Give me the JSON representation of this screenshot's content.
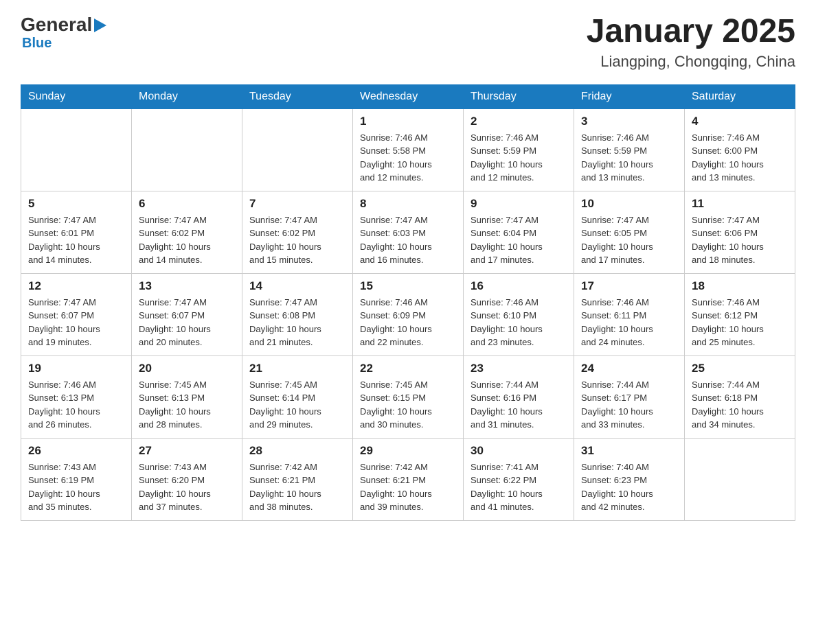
{
  "header": {
    "logo_general": "General",
    "logo_blue": "Blue",
    "month_year": "January 2025",
    "location": "Liangping, Chongqing, China"
  },
  "days_of_week": [
    "Sunday",
    "Monday",
    "Tuesday",
    "Wednesday",
    "Thursday",
    "Friday",
    "Saturday"
  ],
  "weeks": [
    [
      {
        "day": "",
        "info": ""
      },
      {
        "day": "",
        "info": ""
      },
      {
        "day": "",
        "info": ""
      },
      {
        "day": "1",
        "info": "Sunrise: 7:46 AM\nSunset: 5:58 PM\nDaylight: 10 hours\nand 12 minutes."
      },
      {
        "day": "2",
        "info": "Sunrise: 7:46 AM\nSunset: 5:59 PM\nDaylight: 10 hours\nand 12 minutes."
      },
      {
        "day": "3",
        "info": "Sunrise: 7:46 AM\nSunset: 5:59 PM\nDaylight: 10 hours\nand 13 minutes."
      },
      {
        "day": "4",
        "info": "Sunrise: 7:46 AM\nSunset: 6:00 PM\nDaylight: 10 hours\nand 13 minutes."
      }
    ],
    [
      {
        "day": "5",
        "info": "Sunrise: 7:47 AM\nSunset: 6:01 PM\nDaylight: 10 hours\nand 14 minutes."
      },
      {
        "day": "6",
        "info": "Sunrise: 7:47 AM\nSunset: 6:02 PM\nDaylight: 10 hours\nand 14 minutes."
      },
      {
        "day": "7",
        "info": "Sunrise: 7:47 AM\nSunset: 6:02 PM\nDaylight: 10 hours\nand 15 minutes."
      },
      {
        "day": "8",
        "info": "Sunrise: 7:47 AM\nSunset: 6:03 PM\nDaylight: 10 hours\nand 16 minutes."
      },
      {
        "day": "9",
        "info": "Sunrise: 7:47 AM\nSunset: 6:04 PM\nDaylight: 10 hours\nand 17 minutes."
      },
      {
        "day": "10",
        "info": "Sunrise: 7:47 AM\nSunset: 6:05 PM\nDaylight: 10 hours\nand 17 minutes."
      },
      {
        "day": "11",
        "info": "Sunrise: 7:47 AM\nSunset: 6:06 PM\nDaylight: 10 hours\nand 18 minutes."
      }
    ],
    [
      {
        "day": "12",
        "info": "Sunrise: 7:47 AM\nSunset: 6:07 PM\nDaylight: 10 hours\nand 19 minutes."
      },
      {
        "day": "13",
        "info": "Sunrise: 7:47 AM\nSunset: 6:07 PM\nDaylight: 10 hours\nand 20 minutes."
      },
      {
        "day": "14",
        "info": "Sunrise: 7:47 AM\nSunset: 6:08 PM\nDaylight: 10 hours\nand 21 minutes."
      },
      {
        "day": "15",
        "info": "Sunrise: 7:46 AM\nSunset: 6:09 PM\nDaylight: 10 hours\nand 22 minutes."
      },
      {
        "day": "16",
        "info": "Sunrise: 7:46 AM\nSunset: 6:10 PM\nDaylight: 10 hours\nand 23 minutes."
      },
      {
        "day": "17",
        "info": "Sunrise: 7:46 AM\nSunset: 6:11 PM\nDaylight: 10 hours\nand 24 minutes."
      },
      {
        "day": "18",
        "info": "Sunrise: 7:46 AM\nSunset: 6:12 PM\nDaylight: 10 hours\nand 25 minutes."
      }
    ],
    [
      {
        "day": "19",
        "info": "Sunrise: 7:46 AM\nSunset: 6:13 PM\nDaylight: 10 hours\nand 26 minutes."
      },
      {
        "day": "20",
        "info": "Sunrise: 7:45 AM\nSunset: 6:13 PM\nDaylight: 10 hours\nand 28 minutes."
      },
      {
        "day": "21",
        "info": "Sunrise: 7:45 AM\nSunset: 6:14 PM\nDaylight: 10 hours\nand 29 minutes."
      },
      {
        "day": "22",
        "info": "Sunrise: 7:45 AM\nSunset: 6:15 PM\nDaylight: 10 hours\nand 30 minutes."
      },
      {
        "day": "23",
        "info": "Sunrise: 7:44 AM\nSunset: 6:16 PM\nDaylight: 10 hours\nand 31 minutes."
      },
      {
        "day": "24",
        "info": "Sunrise: 7:44 AM\nSunset: 6:17 PM\nDaylight: 10 hours\nand 33 minutes."
      },
      {
        "day": "25",
        "info": "Sunrise: 7:44 AM\nSunset: 6:18 PM\nDaylight: 10 hours\nand 34 minutes."
      }
    ],
    [
      {
        "day": "26",
        "info": "Sunrise: 7:43 AM\nSunset: 6:19 PM\nDaylight: 10 hours\nand 35 minutes."
      },
      {
        "day": "27",
        "info": "Sunrise: 7:43 AM\nSunset: 6:20 PM\nDaylight: 10 hours\nand 37 minutes."
      },
      {
        "day": "28",
        "info": "Sunrise: 7:42 AM\nSunset: 6:21 PM\nDaylight: 10 hours\nand 38 minutes."
      },
      {
        "day": "29",
        "info": "Sunrise: 7:42 AM\nSunset: 6:21 PM\nDaylight: 10 hours\nand 39 minutes."
      },
      {
        "day": "30",
        "info": "Sunrise: 7:41 AM\nSunset: 6:22 PM\nDaylight: 10 hours\nand 41 minutes."
      },
      {
        "day": "31",
        "info": "Sunrise: 7:40 AM\nSunset: 6:23 PM\nDaylight: 10 hours\nand 42 minutes."
      },
      {
        "day": "",
        "info": ""
      }
    ]
  ]
}
